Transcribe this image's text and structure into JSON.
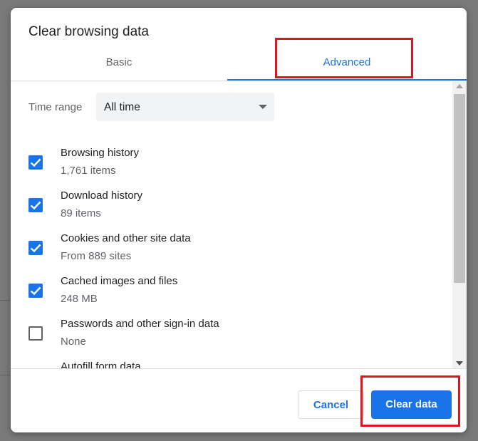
{
  "dialog": {
    "title": "Clear browsing data",
    "tabs": [
      {
        "label": "Basic",
        "selected": false
      },
      {
        "label": "Advanced",
        "selected": true
      }
    ],
    "time_range": {
      "label": "Time range",
      "value": "All time"
    },
    "items": [
      {
        "label": "Browsing history",
        "detail": "1,761 items",
        "checked": true
      },
      {
        "label": "Download history",
        "detail": "89 items",
        "checked": true
      },
      {
        "label": "Cookies and other site data",
        "detail": "From 889 sites",
        "checked": true
      },
      {
        "label": "Cached images and files",
        "detail": "248 MB",
        "checked": true
      },
      {
        "label": "Passwords and other sign-in data",
        "detail": "None",
        "checked": false
      },
      {
        "label": "Autofill form data",
        "detail": "",
        "checked": false
      }
    ],
    "buttons": {
      "cancel": "Cancel",
      "clear": "Clear data"
    }
  },
  "colors": {
    "accent": "#1a73e8",
    "highlight": "#e0131f",
    "backdrop": "#7a7a7a"
  }
}
